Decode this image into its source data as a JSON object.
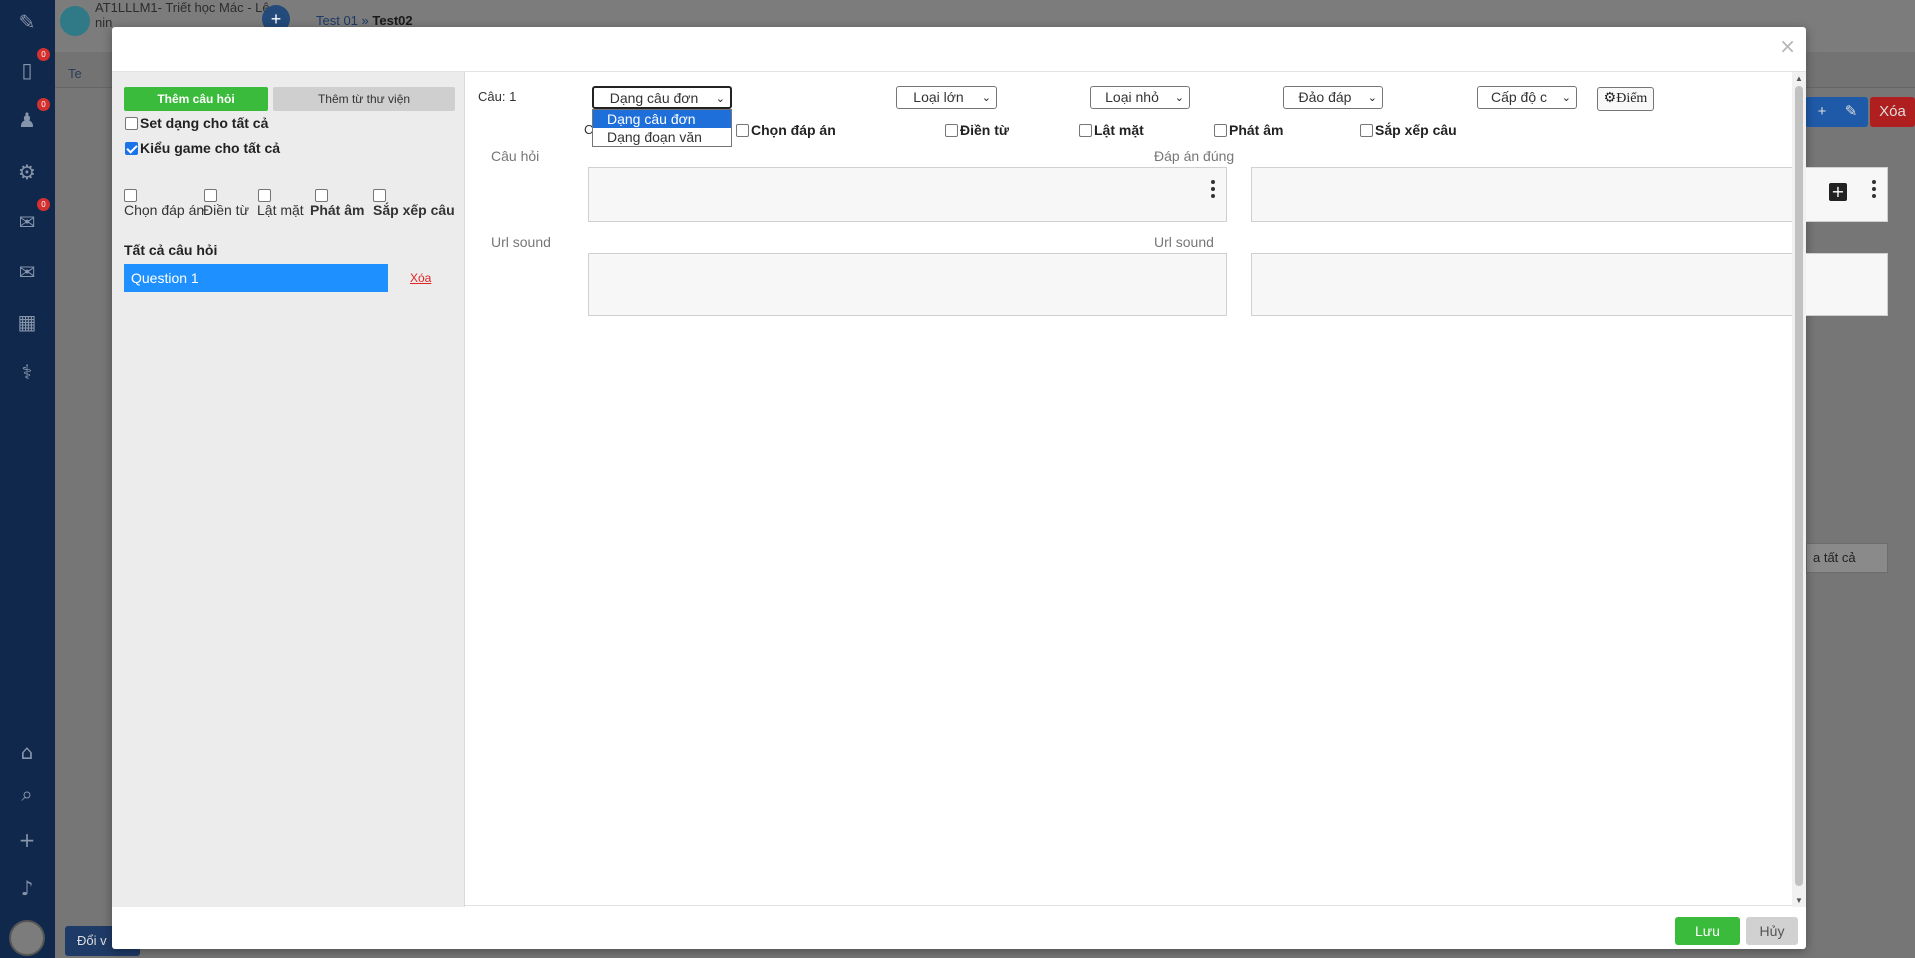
{
  "background": {
    "course_title": "AT1LLLM1- Triết học Mác - Lê nin",
    "breadcrumb": [
      "Test 01",
      "Test02"
    ],
    "tab_label": "Te",
    "sidebar_badges": [
      "0",
      "0",
      "0"
    ],
    "right_label": "a tất cả",
    "switch_label": "Đổi v",
    "action_delete": "Xóa"
  },
  "modal": {
    "close_label": "×",
    "left": {
      "add_question": "Thêm câu hỏi",
      "add_from_library": "Thêm từ thư viện",
      "set_type_all": "Set dạng cho tất cả",
      "set_type_all_checked": false,
      "game_type_all": "Kiểu game cho tất cả",
      "game_type_all_checked": true,
      "game_options": [
        "Chọn đáp án",
        "Điền từ",
        "Lật mặt",
        "Phát âm",
        "Sắp xếp câu"
      ],
      "all_questions": "Tất cả câu hỏi",
      "questions": [
        {
          "label": "Question 1"
        }
      ],
      "delete_label": "Xóa"
    },
    "right": {
      "question_number": "Câu: 1",
      "type_select": "Dạng câu đơn",
      "type_options": [
        "Dạng câu đơn",
        "Dạng đoạn văn"
      ],
      "big_category": "Loại lớn",
      "small_category": "Loại nhỏ",
      "shuffle": "Đảo đáp",
      "level": "Cấp độ c",
      "score_button": "Điểm",
      "hidden_c": "C",
      "game_checks": [
        "Chọn đáp án",
        "Điền từ",
        "Lật mặt",
        "Phát âm",
        "Sắp xếp câu"
      ],
      "question_label": "Câu hỏi",
      "answer_label": "Đáp án đúng",
      "url_sound_left": "Url sound",
      "url_sound_right": "Url sound"
    },
    "footer": {
      "save": "Lưu",
      "cancel": "Hủy"
    }
  },
  "colors": {
    "sidebar": "#10284c",
    "primary_green": "#3bbb3b",
    "selected_blue": "#1e90ff",
    "danger_red": "#e02424"
  }
}
